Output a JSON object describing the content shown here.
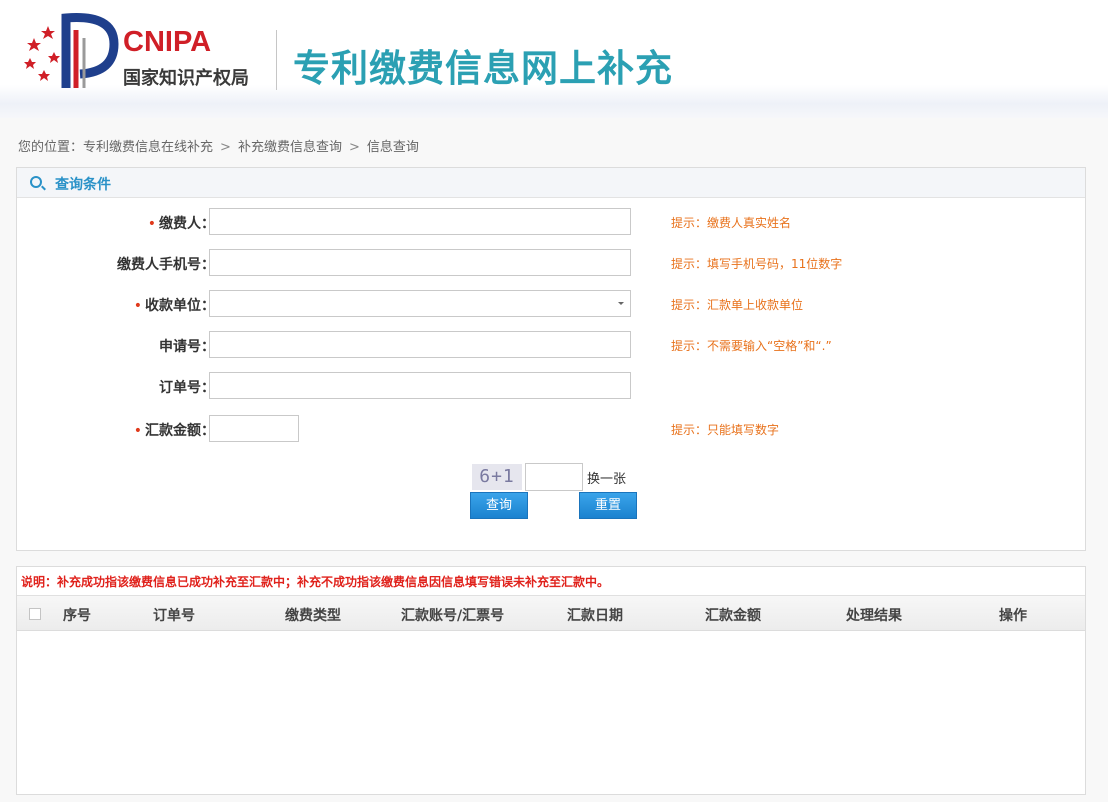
{
  "header": {
    "logo_en": "CNIPA",
    "logo_cn": "国家知识产权局",
    "title": "专利缴费信息网上补充"
  },
  "breadcrumb": {
    "prefix": "您的位置：",
    "items": [
      "专利缴费信息在线补充",
      "补充缴费信息查询",
      "信息查询"
    ]
  },
  "query_panel": {
    "title": "查询条件",
    "fields": {
      "payer": {
        "label": "缴费人：",
        "required": true,
        "value": "",
        "hint": "提示：缴费人真实姓名"
      },
      "phone": {
        "label": "缴费人手机号：",
        "required": false,
        "value": "",
        "hint": "提示：填写手机号码，11位数字"
      },
      "payee": {
        "label": "收款单位：",
        "required": true,
        "value": "",
        "hint": "提示：汇款单上收款单位"
      },
      "application_no": {
        "label": "申请号：",
        "required": false,
        "value": "",
        "hint": "提示：不需要输入“空格”和“.”"
      },
      "order_no": {
        "label": "订单号：",
        "required": false,
        "value": ""
      },
      "amount": {
        "label": "汇款金额：",
        "required": true,
        "value": "",
        "hint": "提示：只能填写数字"
      }
    },
    "captcha": {
      "text": "6+1",
      "input_value": "",
      "refresh_label": "换一张"
    },
    "buttons": {
      "query": "查询",
      "reset": "重置"
    }
  },
  "results": {
    "note": "说明：补充成功指该缴费信息已成功补充至汇款中；补充不成功指该缴费信息因信息填写错误未补充至汇款中。",
    "columns": [
      "序号",
      "订单号",
      "缴费类型",
      "汇款账号/汇票号",
      "汇款日期",
      "汇款金额",
      "处理结果",
      "操作"
    ],
    "rows": []
  },
  "colors": {
    "title": "#2ba0b3",
    "accent": "#2a92c8",
    "hint": "#e8721c",
    "required": "#e03a1c",
    "note": "#e0221c",
    "logo_red": "#d01f27",
    "logo_blue": "#1f3f8c"
  }
}
